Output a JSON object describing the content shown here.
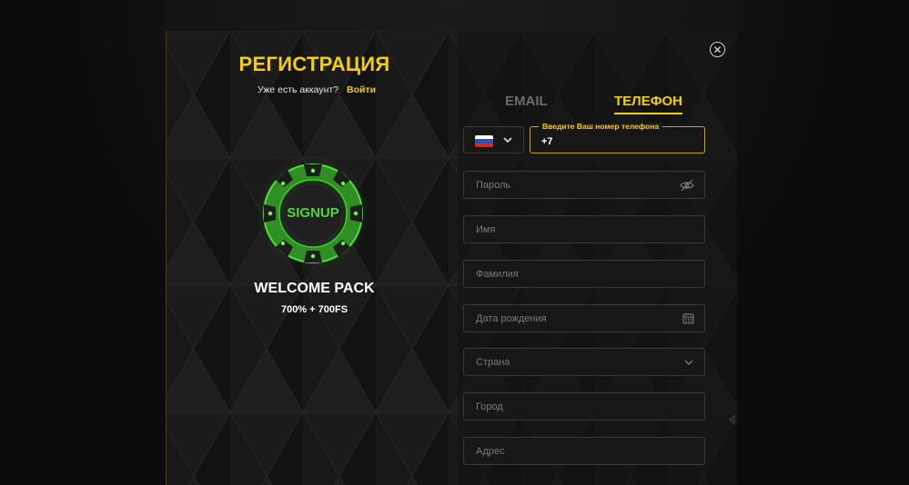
{
  "modal": {
    "title": "РЕГИСТРАЦИЯ",
    "has_account_text": "Уже есть аккаунт?",
    "login_label": "Войти",
    "close_icon": "close-icon"
  },
  "promo": {
    "chip_text": "SIGNUP",
    "welcome_title": "WELCOME PACK",
    "offer": "700% + 700FS"
  },
  "tabs": [
    {
      "label": "EMAIL",
      "active": false
    },
    {
      "label": "ТЕЛЕФОН",
      "active": true
    }
  ],
  "phone": {
    "country_flag": "russia-flag-icon",
    "label": "Введите Ваш номер телефона",
    "value": "+7"
  },
  "fields": {
    "password": {
      "placeholder": "Пароль",
      "icon": "eye-off-icon"
    },
    "first_name": {
      "placeholder": "Имя"
    },
    "last_name": {
      "placeholder": "Фамилия"
    },
    "birth_date": {
      "placeholder": "Дата рождения",
      "icon": "calendar-icon"
    },
    "country": {
      "placeholder": "Страна",
      "icon": "chevron-down-icon"
    },
    "city": {
      "placeholder": "Город"
    },
    "address": {
      "placeholder": "Адрес"
    }
  },
  "colors": {
    "accent": "#f4d000",
    "chip_green": "#29b82f",
    "background": "#151515"
  }
}
